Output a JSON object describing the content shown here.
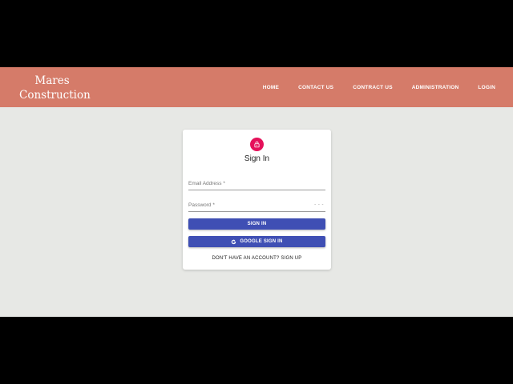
{
  "navbar": {
    "brand_line1": "Mares",
    "brand_line2": "Construction",
    "links": [
      "HOME",
      "CONTACT US",
      "CONTRACT US",
      "ADMINISTRATION",
      "LOGIN"
    ],
    "background": "#d57b69"
  },
  "signin": {
    "title": "Sign In",
    "lock_icon": "lock-icon",
    "lock_color": "#e5115a",
    "email_placeholder": "Email Address *",
    "password_placeholder": "Password *",
    "password_toggle_icon": "visibility-icon",
    "signin_label": "SIGN IN",
    "google_label": "GOOGLE SIGN IN",
    "google_icon": "google-g-icon",
    "button_color": "#3f4fb4",
    "signup_text": "DON'T HAVE AN ACCOUNT? SIGN UP"
  }
}
